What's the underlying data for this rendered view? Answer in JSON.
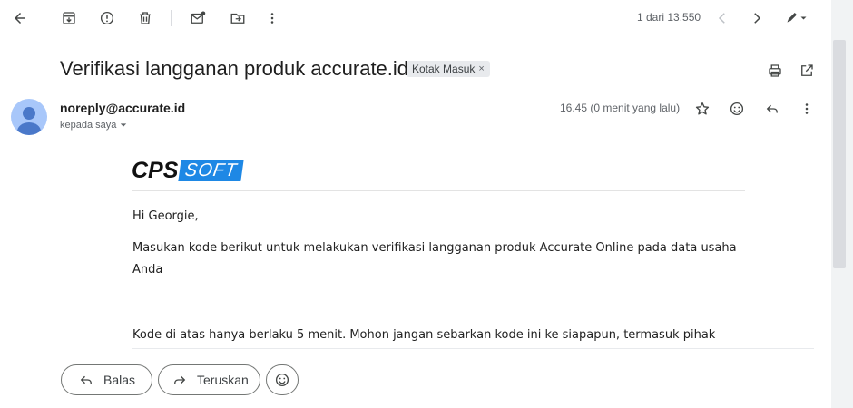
{
  "toolbar": {
    "pager_text": "1 dari 13.550"
  },
  "message": {
    "subject": "Verifikasi langganan produk accurate.id",
    "label": "Kotak Masuk",
    "label_remove": "×",
    "sender": "noreply@accurate.id",
    "recipient": "kepada saya",
    "time": "16.45 (0 menit yang lalu)"
  },
  "email_body": {
    "logo_left": "CPS",
    "logo_right": "SOFT",
    "greeting": "Hi Georgie,",
    "paragraph1": "Masukan kode berikut untuk melakukan verifikasi langganan produk Accurate Online pada data usaha Anda",
    "paragraph2": "Kode di atas hanya berlaku 5 menit. Mohon jangan sebarkan kode ini ke siapapun, termasuk pihak"
  },
  "actions": {
    "reply_label": "Balas",
    "forward_label": "Teruskan"
  },
  "colors": {
    "logo_blue": "#1e88e5",
    "avatar_bg": "#a8c7fa",
    "avatar_fg": "#4a78c9"
  }
}
